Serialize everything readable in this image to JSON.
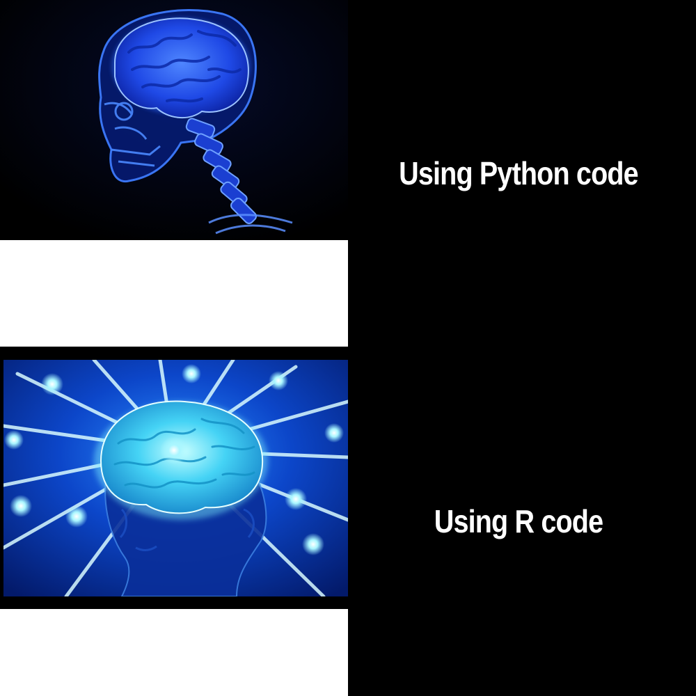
{
  "meme": {
    "panels": [
      {
        "caption": "Using Python code",
        "image": "glowing-skull-brain-image"
      },
      {
        "caption": "Using R code",
        "image": "radiant-brain-image"
      }
    ]
  },
  "colors": {
    "background": "#000000",
    "caption": "#ffffff",
    "brain_blue": "#1e5cff",
    "glow_cyan": "#7ff3ff"
  }
}
